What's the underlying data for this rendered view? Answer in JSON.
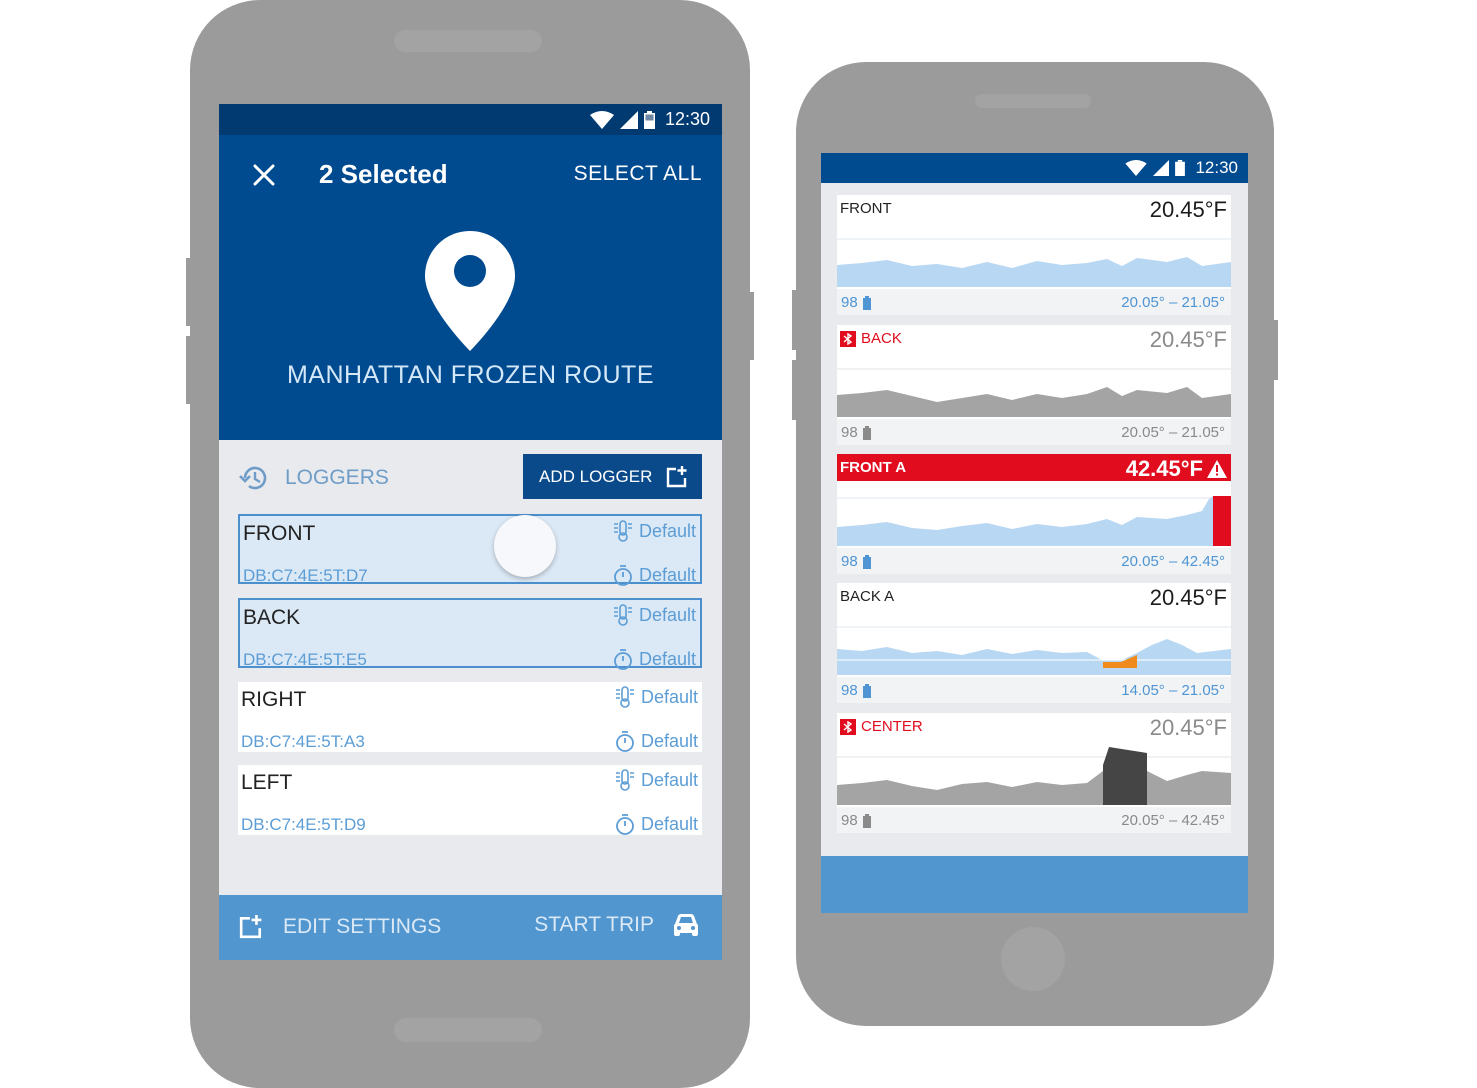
{
  "phone_left": {
    "status_bar": {
      "time": "12:30"
    },
    "header": {
      "selection_title": "2 Selected",
      "select_all": "SELECT ALL",
      "route_name": "MANHATTAN FROZEN ROUTE"
    },
    "loggers_section": {
      "title": "LOGGERS",
      "add_button": "ADD LOGGER"
    },
    "loggers": [
      {
        "name": "FRONT",
        "mac": "DB:C7:4E:5T:D7",
        "temp_profile": "Default",
        "interval": "Default",
        "selected": true
      },
      {
        "name": "BACK",
        "mac": "DB:C7:4E:5T:E5",
        "temp_profile": "Default",
        "interval": "Default",
        "selected": true
      },
      {
        "name": "RIGHT",
        "mac": "DB:C7:4E:5T:A3",
        "temp_profile": "Default",
        "interval": "Default",
        "selected": false
      },
      {
        "name": "LEFT",
        "mac": "DB:C7:4E:5T:D9",
        "temp_profile": "Default",
        "interval": "Default",
        "selected": false
      }
    ],
    "bottom_bar": {
      "edit_settings": "EDIT SETTINGS",
      "start_trip": "START TRIP"
    }
  },
  "phone_right": {
    "status_bar": {
      "time": "12:30"
    },
    "cards": [
      {
        "name": "FRONT",
        "temp": "20.45°F",
        "battery": "98",
        "range": "20.05° – 21.05°",
        "state": "normal"
      },
      {
        "name": "BACK",
        "temp": "20.45°F",
        "battery": "98",
        "range": "20.05° – 21.05°",
        "state": "disconnected"
      },
      {
        "name": "FRONT A",
        "temp": "42.45°F",
        "battery": "98",
        "range": "20.05° – 42.45°",
        "state": "alarm"
      },
      {
        "name": "BACK A",
        "temp": "20.45°F",
        "battery": "98",
        "range": "14.05° – 21.05°",
        "state": "normal"
      },
      {
        "name": "CENTER",
        "temp": "20.45°F",
        "battery": "98",
        "range": "20.05° – 42.45°",
        "state": "disconnected"
      }
    ]
  },
  "colors": {
    "header_blue": "#004a8f",
    "status_blue": "#003a70",
    "bottom_bar_blue": "#5196cf",
    "accent_text": "#5c9dd6",
    "alarm_red": "#e10d1f",
    "chart_light_blue": "#b7d7f2",
    "chart_gray": "#a4a4a4",
    "excursion_orange": "#f08a1c"
  },
  "icons": {
    "close": "close-icon",
    "location": "location-pin-icon",
    "history": "history-icon",
    "add_logger": "add-box-icon",
    "thermometer": "thermometer-icon",
    "timer": "timer-icon",
    "car": "car-icon",
    "battery": "battery-icon",
    "bluetooth_off": "bluetooth-disabled-icon",
    "warning": "warning-icon",
    "wifi": "wifi-icon",
    "signal": "signal-icon"
  }
}
